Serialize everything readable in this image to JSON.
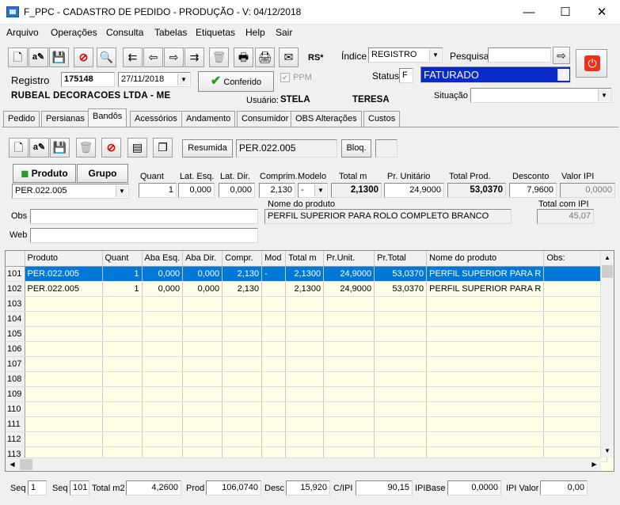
{
  "window": {
    "title": "F_PPC - CADASTRO DE PEDIDO - PRODUÇÃO - V: 04/12/2018",
    "min": "—",
    "max": "☐",
    "close": "✕"
  },
  "menu": [
    "Arquivo",
    "Operações",
    "Consulta",
    "Tabelas",
    "Etiquetas",
    "Help",
    "Sair"
  ],
  "header": {
    "registro_label": "Registro",
    "registro": "175148",
    "date": "27/11/2018",
    "conferido": "Conferido",
    "ppm": "PPM",
    "rs": "RS*",
    "indice_label": "Índice",
    "indice": "REGISTRO",
    "pesquisa_label": "Pesquisa",
    "pesquisa": "",
    "status_label": "Status",
    "status_code": "F",
    "status_text": "FATURADO",
    "company": "RUBEAL DECORACOES LTDA - ME",
    "usuario_label": "Usuário:",
    "usuario": "STELA",
    "usuario2": "TERESA",
    "situacao_label": "Situação",
    "situacao": ""
  },
  "tabs": [
    "Pedido",
    "Persianas",
    "Bandôs",
    "Acessórios",
    "Andamento",
    "Consumidor",
    "OBS Alterações",
    "Custos"
  ],
  "product": {
    "resumida": "Resumida",
    "code_display": "PER.022.005",
    "bloq": "Bloq.",
    "produto_btn": "Produto",
    "grupo_btn": "Grupo",
    "produto_sel": "PER.022.005",
    "labels": {
      "quant": "Quant",
      "lat_esq": "Lat. Esq.",
      "lat_dir": "Lat. Dir.",
      "comprim": "Comprim.",
      "modelo": "Modelo",
      "total_m": "Total m",
      "pr_unit": "Pr. Unitário",
      "total_prod": "Total Prod.",
      "desconto": "Desconto",
      "valor_ipi": "Valor IPI",
      "nome": "Nome do produto",
      "total_ipi": "Total com IPI",
      "obs": "Obs",
      "web": "Web"
    },
    "values": {
      "quant": "1",
      "lat_esq": "0,000",
      "lat_dir": "0,000",
      "comprim": "2,130",
      "modelo": "-",
      "total_m": "2,1300",
      "pr_unit": "24,9000",
      "total_prod": "53,0370",
      "desconto": "7,9600",
      "valor_ipi": "0,0000",
      "nome": "PERFIL SUPERIOR PARA ROLO COMPLETO BRANCO",
      "total_ipi": "45,07",
      "obs": "",
      "web": ""
    }
  },
  "grid": {
    "columns": [
      "Produto",
      "Quant",
      "Aba Esq.",
      "Aba Dir.",
      "Compr.",
      "Mod",
      "Total m",
      "Pr.Unit.",
      "Pr.Total",
      "Nome do produto",
      "Obs:"
    ],
    "rows": [
      {
        "n": "101",
        "cells": [
          "PER.022.005",
          "1",
          "0,000",
          "0,000",
          "2,130",
          "-",
          "2,1300",
          "24,9000",
          "53,0370",
          "PERFIL SUPERIOR PARA R",
          ""
        ]
      },
      {
        "n": "102",
        "cells": [
          "PER.022.005",
          "1",
          "0,000",
          "0,000",
          "2,130",
          "",
          "2,1300",
          "24,9000",
          "53,0370",
          "PERFIL SUPERIOR PARA R",
          ""
        ]
      },
      {
        "n": "103",
        "cells": [
          "",
          "",
          "",
          "",
          "",
          "",
          "",
          "",
          "",
          "",
          ""
        ]
      },
      {
        "n": "104",
        "cells": [
          "",
          "",
          "",
          "",
          "",
          "",
          "",
          "",
          "",
          "",
          ""
        ]
      },
      {
        "n": "105",
        "cells": [
          "",
          "",
          "",
          "",
          "",
          "",
          "",
          "",
          "",
          "",
          ""
        ]
      },
      {
        "n": "106",
        "cells": [
          "",
          "",
          "",
          "",
          "",
          "",
          "",
          "",
          "",
          "",
          ""
        ]
      },
      {
        "n": "107",
        "cells": [
          "",
          "",
          "",
          "",
          "",
          "",
          "",
          "",
          "",
          "",
          ""
        ]
      },
      {
        "n": "108",
        "cells": [
          "",
          "",
          "",
          "",
          "",
          "",
          "",
          "",
          "",
          "",
          ""
        ]
      },
      {
        "n": "109",
        "cells": [
          "",
          "",
          "",
          "",
          "",
          "",
          "",
          "",
          "",
          "",
          ""
        ]
      },
      {
        "n": "110",
        "cells": [
          "",
          "",
          "",
          "",
          "",
          "",
          "",
          "",
          "",
          "",
          ""
        ]
      },
      {
        "n": "111",
        "cells": [
          "",
          "",
          "",
          "",
          "",
          "",
          "",
          "",
          "",
          "",
          ""
        ]
      },
      {
        "n": "112",
        "cells": [
          "",
          "",
          "",
          "",
          "",
          "",
          "",
          "",
          "",
          "",
          ""
        ]
      },
      {
        "n": "113",
        "cells": [
          "",
          "",
          "",
          "",
          "",
          "",
          "",
          "",
          "",
          "",
          ""
        ]
      }
    ]
  },
  "footer": {
    "seq_label": "Seq",
    "seq": "1",
    "seq2_label": "Seq",
    "seq2": "101",
    "total_m2_label": "Total m2",
    "total_m2": "4,2600",
    "prod_label": "Prod",
    "prod": "106,0740",
    "desc_label": "Desc",
    "desc": "15,920",
    "cipi_label": "C/IPI",
    "cipi": "90,15",
    "ipibase_label": "IPIBase",
    "ipibase": "0,0000",
    "ipivalor_label": "IPI Valor",
    "ipivalor": "0,00"
  }
}
